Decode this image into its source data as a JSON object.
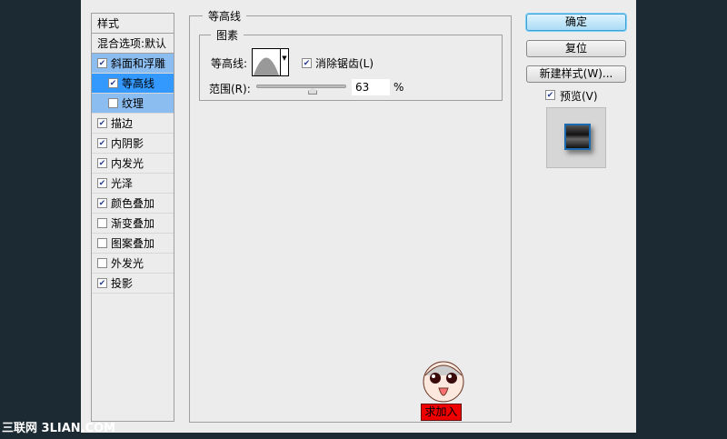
{
  "styles_list": {
    "header": "样式",
    "blending": "混合选项:默认",
    "items": [
      {
        "label": "斜面和浮雕",
        "checked": true
      },
      {
        "label": "等高线",
        "checked": true
      },
      {
        "label": "纹理",
        "checked": false
      },
      {
        "label": "描边",
        "checked": true
      },
      {
        "label": "内阴影",
        "checked": true
      },
      {
        "label": "内发光",
        "checked": true
      },
      {
        "label": "光泽",
        "checked": true
      },
      {
        "label": "颜色叠加",
        "checked": true
      },
      {
        "label": "渐变叠加",
        "checked": false
      },
      {
        "label": "图案叠加",
        "checked": false
      },
      {
        "label": "外发光",
        "checked": false
      },
      {
        "label": "投影",
        "checked": true
      }
    ]
  },
  "panel": {
    "title": "等高线",
    "group": "图素",
    "contour_label": "等高线:",
    "antialias_label": "消除锯齿(L)",
    "antialias_checked": true,
    "range_label": "范围(R):",
    "range_value": "63",
    "range_unit": "%",
    "range_percent": 63
  },
  "buttons": {
    "ok": "确定",
    "reset": "复位",
    "new_style": "新建样式(W)...",
    "preview": "预览(V)",
    "preview_checked": true
  },
  "sticker": {
    "text": "求加入"
  },
  "watermark": "三联网 3LIAN.COM"
}
